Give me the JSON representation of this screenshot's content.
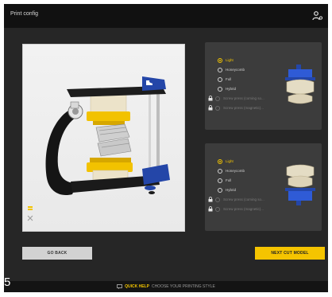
{
  "window": {
    "title": "Print config"
  },
  "header": {
    "user_icon": "user-settings-icon"
  },
  "viewport": {
    "tools": [
      "layers-icon",
      "expand-icon"
    ]
  },
  "panels": [
    {
      "options": [
        {
          "label": "Light",
          "selected": true,
          "locked": false
        },
        {
          "label": "Honeycomb",
          "selected": false,
          "locked": false
        },
        {
          "label": "Full",
          "selected": false,
          "locked": false
        },
        {
          "label": "Hybrid",
          "selected": false,
          "locked": false
        },
        {
          "label": "Screw press (coming so...",
          "selected": false,
          "locked": true
        },
        {
          "label": "Screw press (magnetic)...",
          "selected": false,
          "locked": true
        }
      ]
    },
    {
      "options": [
        {
          "label": "Light",
          "selected": true,
          "locked": false
        },
        {
          "label": "Honeycomb",
          "selected": false,
          "locked": false
        },
        {
          "label": "Full",
          "selected": false,
          "locked": false
        },
        {
          "label": "Hybrid",
          "selected": false,
          "locked": false
        },
        {
          "label": "Screw press (coming so...",
          "selected": false,
          "locked": true
        },
        {
          "label": "Screw press (magnetic)...",
          "selected": false,
          "locked": true
        }
      ]
    }
  ],
  "buttons": {
    "back": "GO BACK",
    "next": "NEXT CUT MODEL"
  },
  "page_number": "5",
  "help": {
    "label": "QUICK HELP",
    "text": "CHOOSE YOUR PRINTING STYLE"
  },
  "colors": {
    "accent": "#f5c400",
    "background": "#262626",
    "panel": "#3c3c3c"
  }
}
